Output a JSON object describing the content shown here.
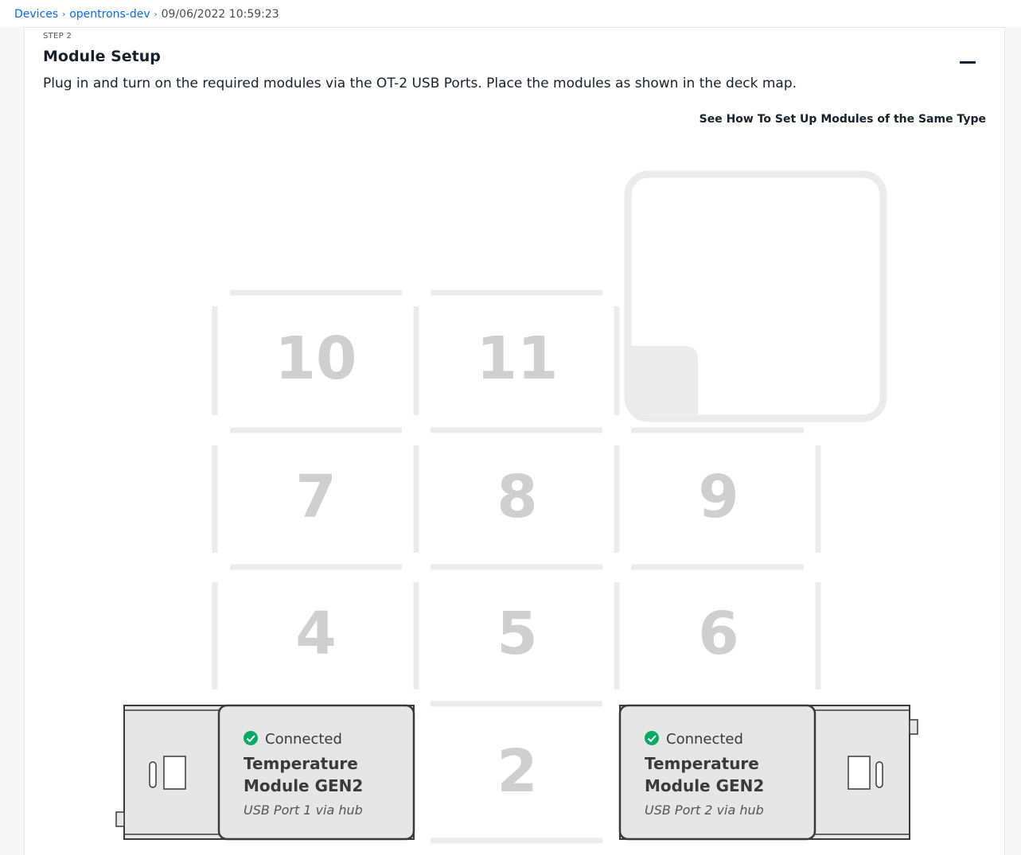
{
  "breadcrumb": {
    "items": [
      "Devices",
      "opentrons-dev"
    ],
    "current": "09/06/2022 10:59:23",
    "separator": "›"
  },
  "step": {
    "label": "STEP 2",
    "title": "Module Setup",
    "description": "Plug in and turn on the required modules via the OT-2 USB Ports. Place the modules as shown in the deck map.",
    "link": "See How To Set Up Modules of the Same Type",
    "collapse_icon": "minus-icon"
  },
  "deck": {
    "slots": [
      "10",
      "11",
      "7",
      "8",
      "9",
      "4",
      "5",
      "6",
      "2"
    ],
    "trash_icon": "trash-outline",
    "slot_color": "#cfcfcf"
  },
  "modules": [
    {
      "status": "Connected",
      "status_icon": "check-circle-icon",
      "name_line1": "Temperature",
      "name_line2": "Module GEN2",
      "port": "USB Port 1 via hub"
    },
    {
      "status": "Connected",
      "status_icon": "check-circle-icon",
      "name_line1": "Temperature",
      "name_line2": "Module GEN2",
      "port": "USB Port 2 via hub"
    }
  ],
  "colors": {
    "link_blue": "#006cfa",
    "connected_green": "#04aa65",
    "module_fill": "#e6e6e6",
    "module_stroke": "#3a3a3a"
  }
}
